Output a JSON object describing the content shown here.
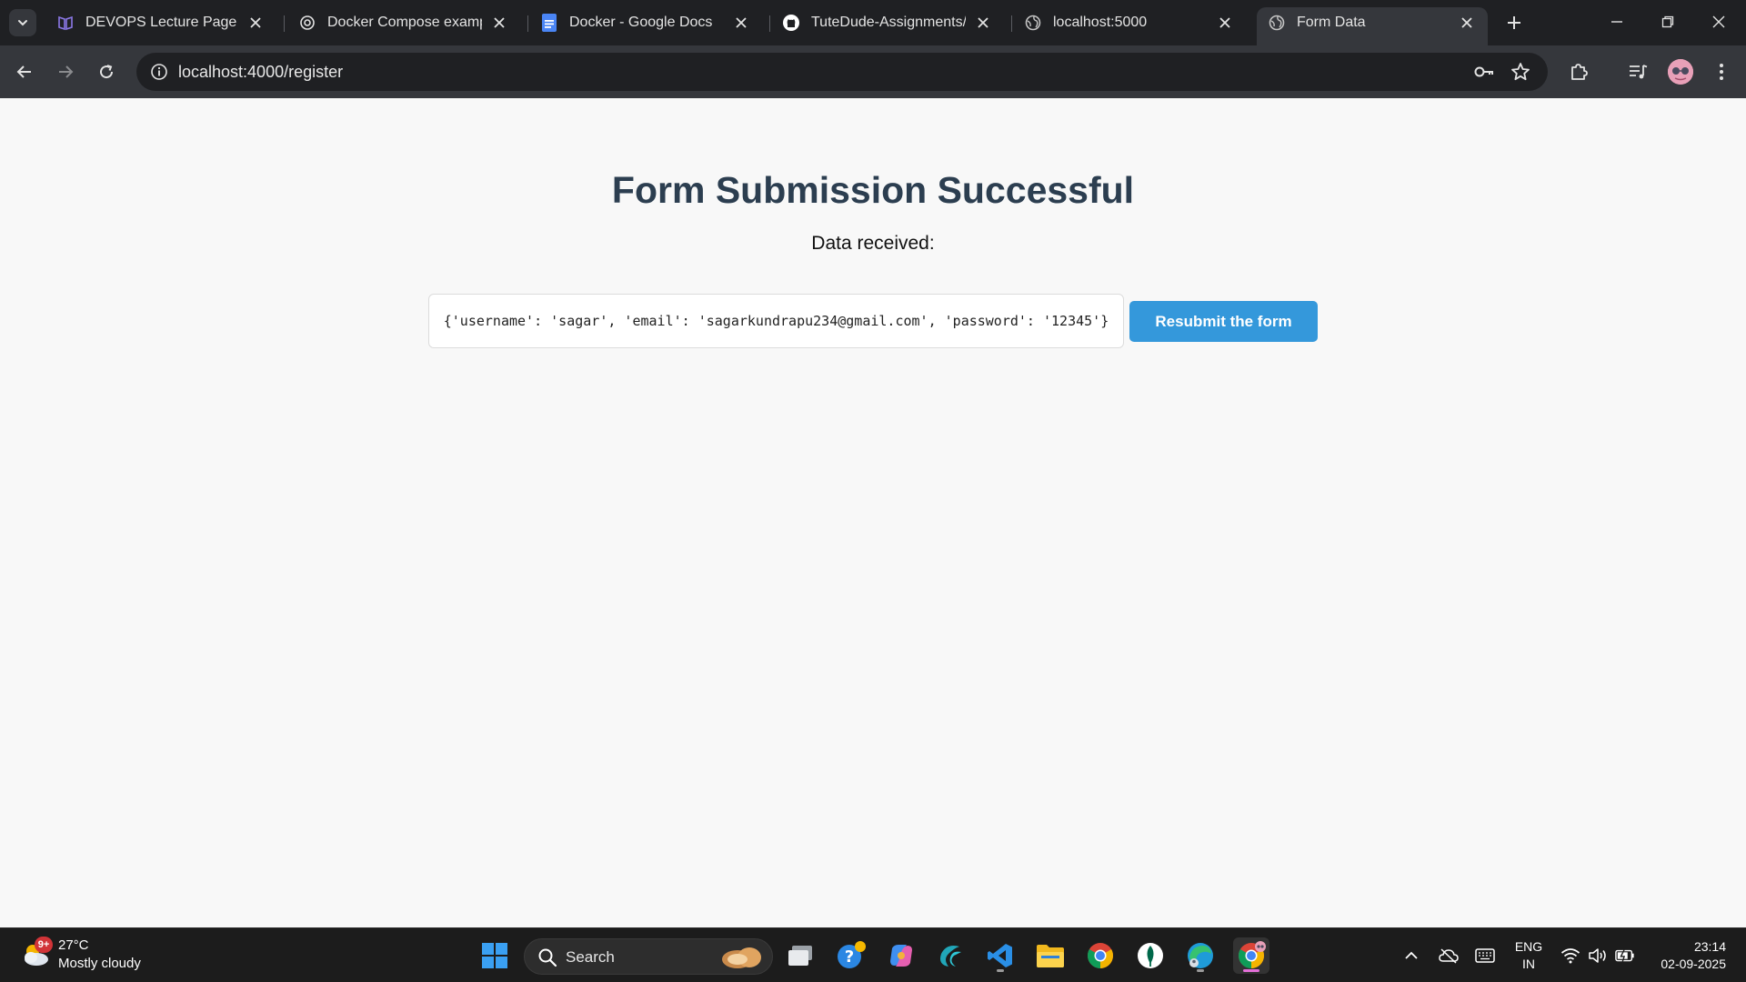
{
  "browser": {
    "tabs": [
      {
        "title": "DEVOPS Lecture Page",
        "icon": "book-icon"
      },
      {
        "title": "Docker Compose example",
        "icon": "chatgpt-icon"
      },
      {
        "title": "Docker - Google Docs",
        "icon": "google-docs-icon"
      },
      {
        "title": "TuteDude-Assignments/As",
        "icon": "github-icon"
      },
      {
        "title": "localhost:5000",
        "icon": "globe-icon"
      },
      {
        "title": "Form Data",
        "icon": "globe-icon",
        "active": true
      }
    ],
    "url": "localhost:4000/register",
    "accent": "#35373c"
  },
  "page": {
    "title": "Form Submission Successful",
    "data_label": "Data received:",
    "data_text": "{'username': 'sagar', 'email': 'sagarkundrapu234@gmail.com', 'password': '12345'}",
    "resubmit_label": "Resubmit the form",
    "title_color": "#2c3e50",
    "button_color": "#3498db"
  },
  "taskbar": {
    "weather_badge": "9+",
    "weather_temp": "27°C",
    "weather_desc": "Mostly cloudy",
    "search_label": "Search",
    "lang_line1": "ENG",
    "lang_line2": "IN",
    "time": "23:14",
    "date": "02-09-2025"
  }
}
